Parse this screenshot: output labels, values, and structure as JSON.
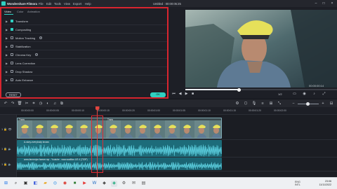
{
  "app": {
    "name": "Wondershare Filmora",
    "menu": [
      "File",
      "Edit",
      "Tools",
      "View",
      "Export",
      "Help"
    ],
    "doc_title": "Untitled : 00:00:05:25"
  },
  "panel": {
    "tabs": [
      "Video",
      "Color",
      "Animation"
    ],
    "active_tab": "Video",
    "rows": [
      {
        "label": "Transform",
        "checked": true
      },
      {
        "label": "Compositing",
        "checked": true
      },
      {
        "label": "Motion Tracking",
        "checked": false
      },
      {
        "label": "Stabilization",
        "checked": false
      },
      {
        "label": "Chroma Key",
        "checked": false
      },
      {
        "label": "Lens Correction",
        "checked": false
      },
      {
        "label": "Drop Shadow",
        "checked": false
      },
      {
        "label": "Auto Enhance",
        "checked": false
      }
    ],
    "reset_label": "RESET",
    "ok_label": "OK"
  },
  "preview": {
    "timecode": "00:00:00:14",
    "quality": "1/2",
    "playback_progress": 0.35
  },
  "ruler": {
    "ticks": [
      "00:00:00:00",
      "00:00:00:05",
      "00:00:00:10",
      "00:00:00:15",
      "00:00:00:20",
      "00:00:01:00",
      "00:00:01:05",
      "00:00:01:10",
      "00:00:01:15",
      "00:00:01:20",
      "00:00:02:00"
    ]
  },
  "tracks": {
    "video_label_1": "Trans",
    "video_label_2": "Trans",
    "audio1_label": "A-story-everybody knows",
    "audio2_label": "www.farmerjoe.farmer.mp - Youtube - www.audilion.US 4 (720P)",
    "heads": [
      "1",
      "1",
      "1"
    ]
  },
  "taskbar": {
    "tray": "ENG\nINTL",
    "time": "23:06",
    "date": "11/11/2022"
  },
  "colors": {
    "accent": "#2fd0c1",
    "highlight": "#e02a33",
    "playhead": "#e0453f"
  }
}
